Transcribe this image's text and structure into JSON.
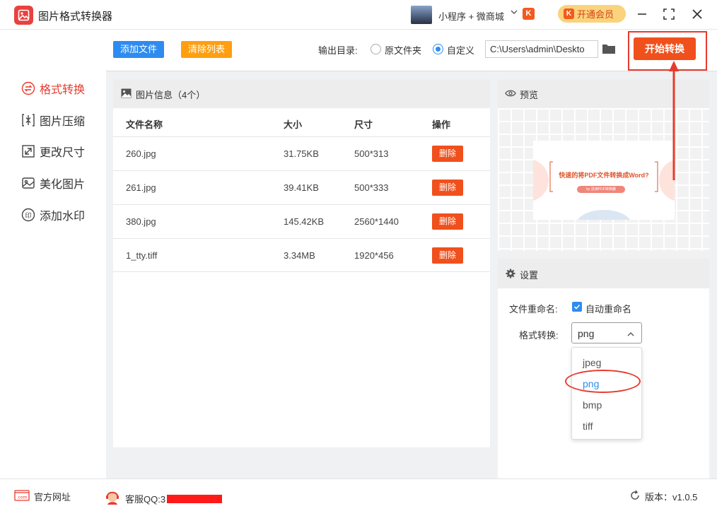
{
  "app": {
    "title": "图片格式转换器"
  },
  "account": {
    "mini_label": "小程序 + 微商城",
    "vip_label": "开通会员"
  },
  "sidebar": {
    "items": [
      {
        "label": "格式转换",
        "icon": "format-convert-icon",
        "active": true
      },
      {
        "label": "图片压缩",
        "icon": "compress-icon",
        "active": false
      },
      {
        "label": "更改尺寸",
        "icon": "resize-icon",
        "active": false
      },
      {
        "label": "美化图片",
        "icon": "beautify-icon",
        "active": false
      },
      {
        "label": "添加水印",
        "icon": "watermark-icon",
        "active": false
      }
    ]
  },
  "toolbar": {
    "add_label": "添加文件",
    "clear_label": "清除列表",
    "output_label": "输出目录:",
    "radio_original": "原文件夹",
    "radio_custom": "自定义",
    "selected_output": "custom",
    "path": "C:\\Users\\admin\\Deskto",
    "start_label": "开始转换"
  },
  "files": {
    "title": "图片信息（4个）",
    "columns": {
      "name": "文件名称",
      "size": "大小",
      "dims": "尺寸",
      "action": "操作"
    },
    "delete_label": "删除",
    "rows": [
      {
        "name": "260.jpg",
        "size": "31.75KB",
        "dims": "500*313"
      },
      {
        "name": "261.jpg",
        "size": "39.41KB",
        "dims": "500*333"
      },
      {
        "name": "380.jpg",
        "size": "145.42KB",
        "dims": "2560*1440"
      },
      {
        "name": "1_tty.tiff",
        "size": "3.34MB",
        "dims": "1920*456"
      }
    ]
  },
  "preview": {
    "title": "预览",
    "card_title": "快速的将PDF文件转换成Word?",
    "card_pill": "by 迅读PDF转换器"
  },
  "settings": {
    "title": "设置",
    "rename_label": "文件重命名:",
    "rename_checkbox_label": "自动重命名",
    "rename_checked": true,
    "format_label": "格式转换:",
    "format_value": "png",
    "format_options": [
      "jpeg",
      "png",
      "bmp",
      "tiff"
    ]
  },
  "footer": {
    "website_label": "官方网址",
    "qq_label": "客服QQ:3",
    "version_label": "版本：v1.0.5"
  },
  "colors": {
    "accent": "#2d8cf0",
    "primary_action": "#f0501c",
    "highlight": "#e63b2e",
    "warning": "#ff9f0f"
  }
}
